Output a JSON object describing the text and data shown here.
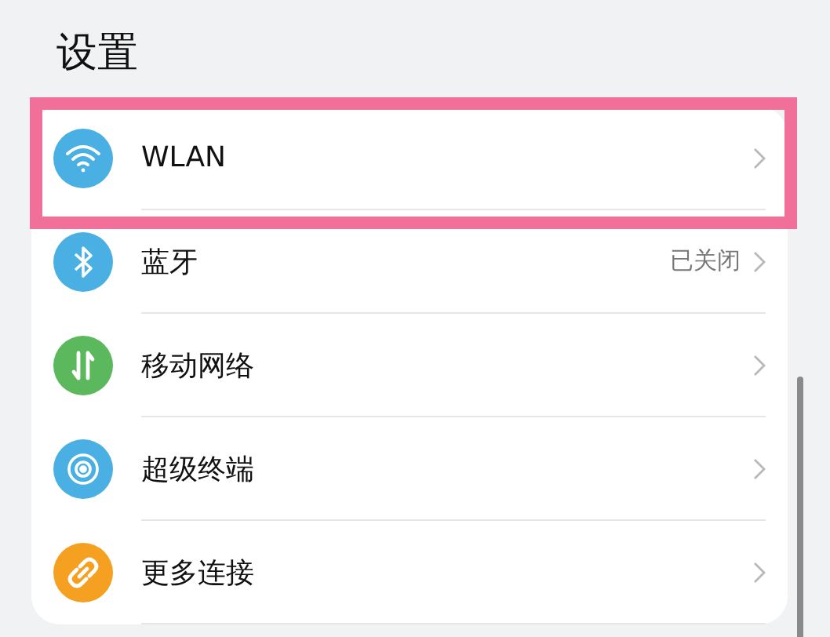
{
  "title": "设置",
  "items": [
    {
      "label": "WLAN",
      "color": "#4aafe3",
      "highlighted": true
    },
    {
      "label": "蓝牙",
      "value": "已关闭",
      "color": "#4aafe3",
      "highlighted": false
    },
    {
      "label": "移动网络",
      "color": "#5cb85c",
      "highlighted": false
    },
    {
      "label": "超级终端",
      "color": "#4aafe3",
      "highlighted": false
    },
    {
      "label": "更多连接",
      "color": "#f5a020",
      "highlighted": false
    }
  ]
}
